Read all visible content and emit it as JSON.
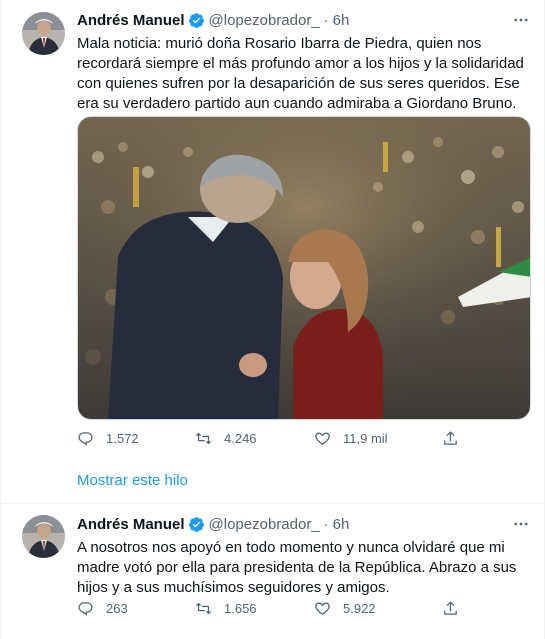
{
  "tweets": [
    {
      "author": "Andrés Manuel",
      "handle": "@lopezobrador_",
      "separator": "·",
      "time": "6h",
      "text": "Mala noticia: murió doña Rosario Ibarra de Piedra, quien nos recordará siempre el más profundo amor a los hijos y la solidaridad con quienes sufren por la desaparición de sus seres queridos. Ese era su verdadero partido aun cuando admiraba a Giordano Bruno.",
      "replies": "1.572",
      "retweets": "4.246",
      "likes": "11,9 mil",
      "show_thread": "Mostrar este hilo"
    },
    {
      "author": "Andrés Manuel",
      "handle": "@lopezobrador_",
      "separator": "·",
      "time": "6h",
      "text": "A nosotros nos apoyó en todo momento y nunca olvidaré que mi madre votó por ella para presidenta de la República. Abrazo a sus hijos y a sus muchísimos seguidores y amigos.",
      "replies": "263",
      "retweets": "1.656",
      "likes": "5.922"
    }
  ],
  "icons": {
    "verified": "verified-badge-icon",
    "more": "more-options-icon",
    "reply": "reply-icon",
    "retweet": "retweet-icon",
    "like": "like-icon",
    "share": "share-icon"
  },
  "colors": {
    "accent": "#1d9bf0",
    "secondary_text": "#536471",
    "primary_text": "#0f1419",
    "border": "#eff3f4"
  }
}
